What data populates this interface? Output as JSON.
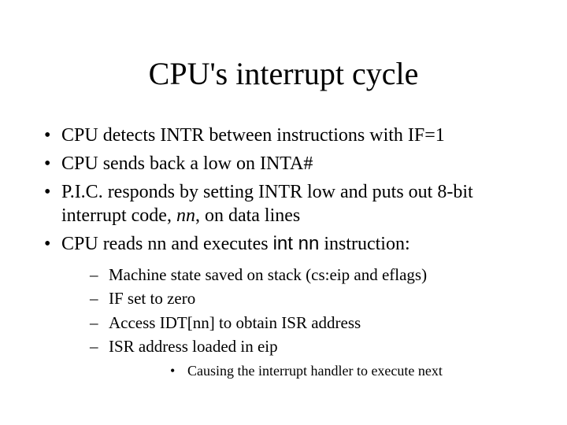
{
  "title": "CPU's interrupt cycle",
  "bullets": {
    "b1": "CPU detects INTR between instructions with IF=1",
    "b2": "CPU sends back a low on INTA#",
    "b3_a": "P.I.C. responds by setting INTR low and puts out 8-bit interrupt code, ",
    "b3_nn": "nn",
    "b3_b": ", on data lines",
    "b4_a": "CPU reads nn and executes ",
    "b4_code": "int nn",
    "b4_b": " instruction:"
  },
  "sub": {
    "s1": "Machine state saved on stack (cs:eip and eflags)",
    "s2": "IF set to zero",
    "s3": "Access IDT[nn] to obtain ISR address",
    "s4": "ISR address loaded in eip"
  },
  "subsub": {
    "ss1": "Causing the interrupt handler to execute next"
  }
}
